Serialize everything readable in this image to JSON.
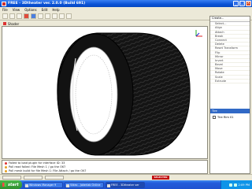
{
  "window": {
    "title": "FREE - 3Dtheater ver. 2.0.0 (Build 691)",
    "controls": [
      "_",
      "□",
      "×"
    ]
  },
  "menubar": [
    "File",
    "View",
    "Options",
    "Edit",
    "Help"
  ],
  "viewport": {
    "tab_label": "Shader"
  },
  "context_menu": {
    "title": "Create...",
    "items": [
      "Select...",
      "Align",
      "Attach",
      "Break",
      "Connect",
      "Delete",
      "Reset Transform",
      "Flip",
      "Mirror",
      "Invert",
      "Bevel",
      "Move",
      "Rotate",
      "Scale",
      "Extrude"
    ]
  },
  "panel": {
    "header": "Tire",
    "item": "Tire Rim 01"
  },
  "log": [
    {
      "text": "Failed to load plugin for interface ID: 33",
      "level": "error"
    },
    {
      "text": "Poll read failed: File Mesh 1 / go the OK?",
      "level": "warn"
    },
    {
      "text": "Poll mesh build for file Mesh 1: File Attach / go the OK?",
      "level": "warn"
    }
  ],
  "statusbar": {
    "selected": "SELECTED MODE"
  },
  "taskbar": {
    "start": "start",
    "tasks": [
      "Windows Manager 9",
      "Video - Jokerlab Online",
      "FREE - 3Dtheater ver"
    ],
    "clock": "2:09 PM"
  },
  "colors": {
    "accent": "#0a52d6",
    "selected_mode": "#c01010",
    "start": "#2f8f2f"
  }
}
